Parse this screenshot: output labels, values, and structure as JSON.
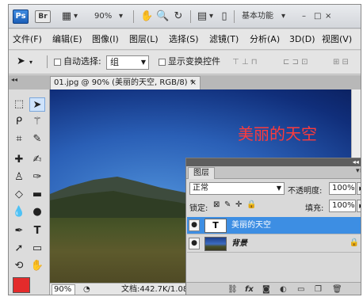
{
  "titlebar": {
    "ps_logo": "Ps",
    "br_logo": "Br",
    "zoom": "90%",
    "workspace": "基本功能",
    "minimize": "–",
    "maximize": "□",
    "close": "×"
  },
  "menu": [
    "文件(F)",
    "编辑(E)",
    "图像(I)",
    "图层(L)",
    "选择(S)",
    "滤镜(T)",
    "分析(A)",
    "3D(D)",
    "视图(V)"
  ],
  "options": {
    "auto_select_label": "自动选择:",
    "auto_select_value": "组",
    "show_transform_label": "显示变换控件"
  },
  "document": {
    "tab_title": "01.jpg @ 90% (美丽的天空, RGB/8) *",
    "tab_close": "×",
    "canvas_text": "美丽的天空"
  },
  "status": {
    "zoom": "90%",
    "doc_info": "文档:442.7K/1.08M"
  },
  "layers_panel": {
    "collapse": "◂◂ ×",
    "tab": "图层",
    "menu_glyph": "▾≡",
    "blend_mode": "正常",
    "opacity_label": "不透明度:",
    "opacity_value": "100%",
    "lock_label": "锁定:",
    "fill_label": "填充:",
    "fill_value": "100%",
    "layers": [
      {
        "name": "美丽的天空",
        "thumb": "T",
        "type": "text",
        "selected": true
      },
      {
        "name": "背景",
        "type": "image",
        "selected": false,
        "locked": true
      }
    ]
  },
  "colors": {
    "foreground": "#e32b2b",
    "selection": "#3d8ee3",
    "canvas_text": "#ff3b3b"
  }
}
